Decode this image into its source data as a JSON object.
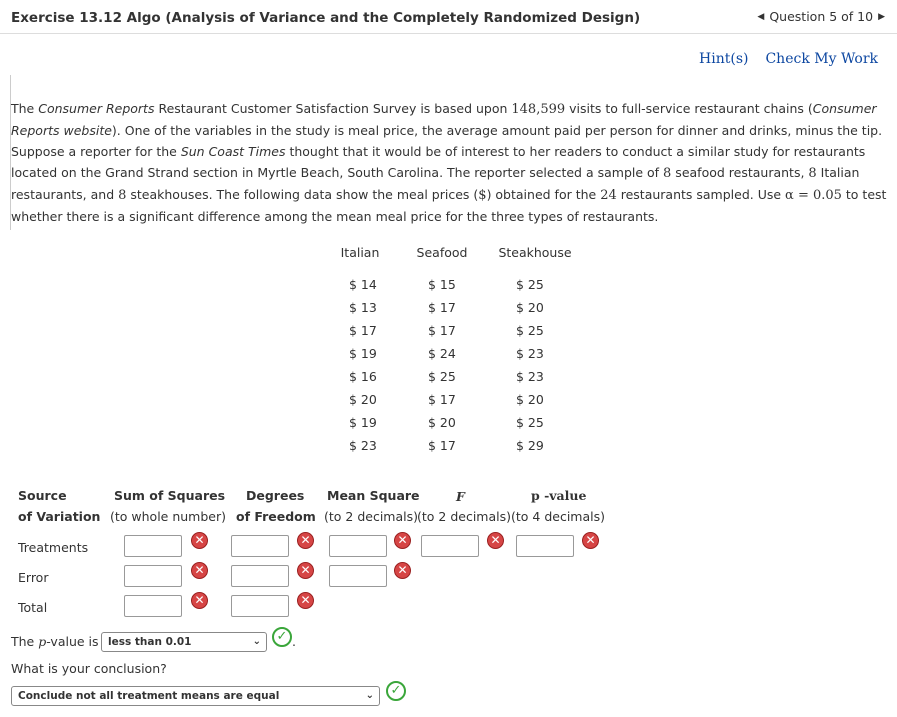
{
  "header": {
    "title": "Exercise 13.12 Algo (Analysis of Variance and the Completely Randomized Design)",
    "question_nav": "Question 5 of 10"
  },
  "hintbar": {
    "hints": "Hint(s)",
    "check": "Check My Work"
  },
  "problem": {
    "p1": "The ",
    "p2": "Consumer Reports",
    "p3": " Restaurant Customer Satisfaction Survey is based upon ",
    "p4": "148,599",
    "p5": " visits to full-service restaurant chains (",
    "p6": "Consumer Reports website",
    "p7": "). One of the variables in the study is meal price, the average amount paid per person for dinner and drinks, minus the tip. Suppose a reporter for the ",
    "p8": "Sun Coast Times",
    "p9": " thought that it would be of interest to her readers to conduct a similar study for restaurants located on the Grand Strand section in Myrtle Beach, South Carolina. The reporter selected a sample of ",
    "p10": "8",
    "p11": " seafood restaurants, ",
    "p12": "8",
    "p13": " Italian restaurants, and ",
    "p14": "8",
    "p15": " steakhouses. The following data show the meal prices (",
    "p16": "$",
    "p17": ") obtained for the ",
    "p18": "24",
    "p19": " restaurants sampled. Use ",
    "p20": "α = 0.05",
    "p21": " to test whether there is a significant difference among the mean meal price for the three types of restaurants."
  },
  "table": {
    "columns": [
      {
        "name": "Italian",
        "values": [
          "$ 14",
          "$ 13",
          "$ 17",
          "$ 19",
          "$ 16",
          "$ 20",
          "$ 19",
          "$ 23"
        ]
      },
      {
        "name": "Seafood",
        "values": [
          "$ 15",
          "$ 17",
          "$ 17",
          "$ 24",
          "$ 25",
          "$ 17",
          "$ 20",
          "$ 17"
        ]
      },
      {
        "name": "Steakhouse",
        "values": [
          "$ 25",
          "$ 20",
          "$ 25",
          "$ 23",
          "$ 23",
          "$ 20",
          "$ 25",
          "$ 29"
        ]
      }
    ]
  },
  "anova": {
    "h_source": "Source",
    "h_source2": "of Variation",
    "h_ss": "Sum of Squares",
    "h_ss2": "(to whole number)",
    "h_df": "Degrees",
    "h_df2": "of Freedom",
    "h_ms": "Mean Square",
    "h_ms2": "(to 2 decimals)",
    "h_f": "F",
    "h_f2": "(to 2 decimals)",
    "h_p": "p -value",
    "h_p2": "(to 4 decimals)",
    "rows": [
      "Treatments",
      "Error",
      "Total"
    ]
  },
  "pvalue": {
    "prefix": "The ",
    "p": "p",
    "mid": "-value is",
    "selected": "less than 0.01",
    "suffix": "."
  },
  "conclusion": {
    "question": "What is your conclusion?",
    "selected": "Conclude not all treatment means are equal"
  }
}
